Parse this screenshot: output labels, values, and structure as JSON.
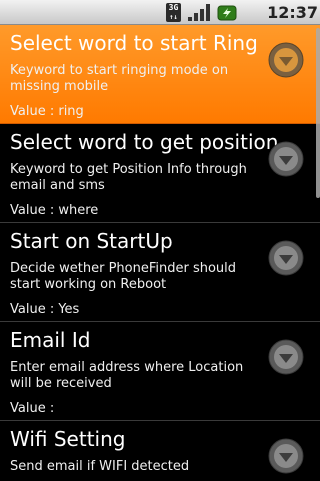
{
  "status_bar": {
    "network_label": "3G",
    "time": "12:37 AM",
    "icons": [
      "3g-data-icon",
      "signal-strength-icon",
      "battery-charging-icon"
    ]
  },
  "colors": {
    "selected_bg": "#ff8a10",
    "divider": "#3a3a3a",
    "background": "#000000"
  },
  "preferences": [
    {
      "title": "Select word to start Ring",
      "summary": "Keyword to start ringing mode on missing mobile",
      "value": "Value : ring",
      "selected": true
    },
    {
      "title": "Select word to get position",
      "summary": "Keyword to get Position Info through email and sms",
      "value": "Value : where",
      "selected": false
    },
    {
      "title": "Start on StartUp",
      "summary": "Decide wether PhoneFinder should start working on Reboot",
      "value": "Value : Yes",
      "selected": false
    },
    {
      "title": "Email Id",
      "summary": "Enter email address where Location will be received",
      "value": "Value :",
      "selected": false
    },
    {
      "title": "Wifi Setting",
      "summary": "Send email if WIFI detected",
      "value": "",
      "selected": false
    }
  ]
}
